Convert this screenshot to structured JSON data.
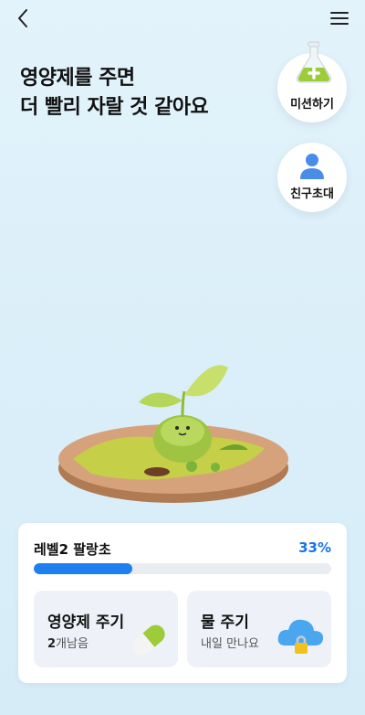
{
  "header": {
    "back_icon": "chevron-left-icon",
    "menu_icon": "hamburger-menu-icon"
  },
  "headline": {
    "line1": "영양제를 주면",
    "line2": "더 빨리 자랄 것 같아요"
  },
  "side_buttons": {
    "mission": {
      "label": "미션하기",
      "icon": "flask-plus-icon"
    },
    "invite": {
      "label": "친구초대",
      "icon": "person-icon"
    }
  },
  "status": {
    "level_label": "레벨2 팔랑초",
    "percent_text": "33%",
    "progress": 0.33
  },
  "actions": {
    "nutrient": {
      "title": "영양제 주기",
      "count": "2",
      "sub": "개남음",
      "icon": "pill-capsule-icon"
    },
    "water": {
      "title": "물 주기",
      "sub": "내일 만나요",
      "icon": "locked-cloud-icon"
    }
  },
  "colors": {
    "accent": "#1f7ff0",
    "bg": "#dbeff9"
  }
}
